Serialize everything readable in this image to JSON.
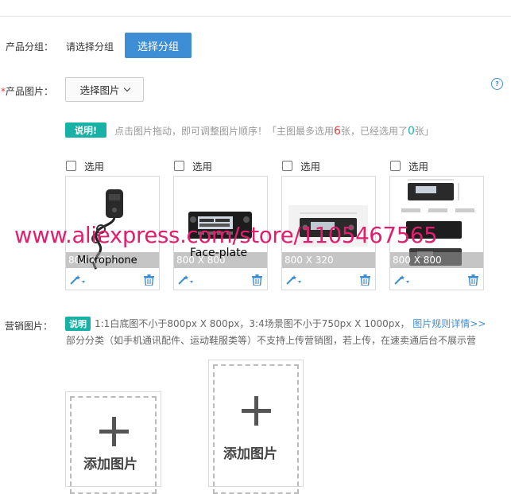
{
  "group": {
    "label": "产品分组：",
    "current": "请选择分组",
    "button": "选择分组"
  },
  "images": {
    "required_mark": "*",
    "label": "产品图片：",
    "select_button": "选择图片",
    "help_icon": "help-icon",
    "tip": {
      "badge": "说明!",
      "text_a": "点击图片拖动，即可调整图片顺序！「主图最多选用",
      "max": "6",
      "text_b": "张，已经选用了",
      "used": "0",
      "text_c": "张」"
    },
    "select_label": "选用",
    "items": [
      {
        "size": "800 X 800",
        "caption": "Microphone"
      },
      {
        "size": "800 X 800",
        "caption": "Face-plate"
      },
      {
        "size": "800 X 320",
        "caption": ""
      },
      {
        "size": "800 X 800",
        "caption": ""
      }
    ]
  },
  "watermark": "www.aliexpress.com/store/1105467565",
  "marketing": {
    "label": "营销图片：",
    "badge": "说明",
    "line1": "1:1白底图不小于800px X 800px，3:4场景图不小于750px X 1000px，",
    "rule_link": "图片规则详情>>",
    "line2": "部分分类（如手机通讯配件、运动鞋服类等）不支持上传营销图，若上传，在速卖通后台不展示营",
    "add_square": "添加图片",
    "add_portrait": "添加图片"
  },
  "colors": {
    "primary": "#3d8ed5",
    "teal": "#17b2a5",
    "required": "#e4393c",
    "watermark": "#e11e6e"
  }
}
